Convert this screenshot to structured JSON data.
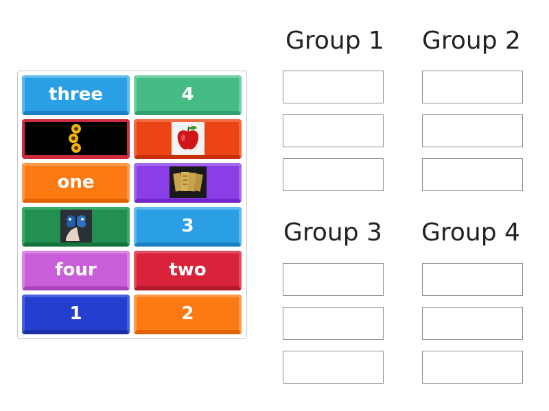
{
  "groups": [
    {
      "title": "Group 1"
    },
    {
      "title": "Group 2"
    },
    {
      "title": "Group 3"
    },
    {
      "title": "Group 4"
    }
  ],
  "tiles": [
    {
      "label": "three",
      "kind": "text",
      "fill": "#2b9fe6",
      "edge": "#1b7fc4"
    },
    {
      "label": "4",
      "kind": "text",
      "fill": "#45bc86",
      "edge": "#34a06f"
    },
    {
      "kind": "image",
      "icon": "sunflowers-image",
      "fill": "#000000",
      "edge": "#cf2b3f"
    },
    {
      "kind": "image",
      "icon": "apple-image",
      "fill": "#ec4414",
      "edge": "#c7300a"
    },
    {
      "label": "one",
      "kind": "text",
      "fill": "#fd7a12",
      "edge": "#e06405"
    },
    {
      "kind": "image",
      "icon": "tickets-image",
      "fill": "#8a3ee6",
      "edge": "#6f27c9"
    },
    {
      "kind": "image",
      "icon": "butterflies-image",
      "fill": "#229050",
      "edge": "#15733d"
    },
    {
      "label": "3",
      "kind": "text",
      "fill": "#2b9fe6",
      "edge": "#1b7fc4"
    },
    {
      "label": "four",
      "kind": "text",
      "fill": "#c85fd8",
      "edge": "#a946bb"
    },
    {
      "label": "two",
      "kind": "text",
      "fill": "#d9233a",
      "edge": "#b3172c"
    },
    {
      "label": "1",
      "kind": "text",
      "fill": "#243fd0",
      "edge": "#1a2fa8"
    },
    {
      "label": "2",
      "kind": "text",
      "fill": "#fd7a12",
      "edge": "#e06405"
    }
  ]
}
